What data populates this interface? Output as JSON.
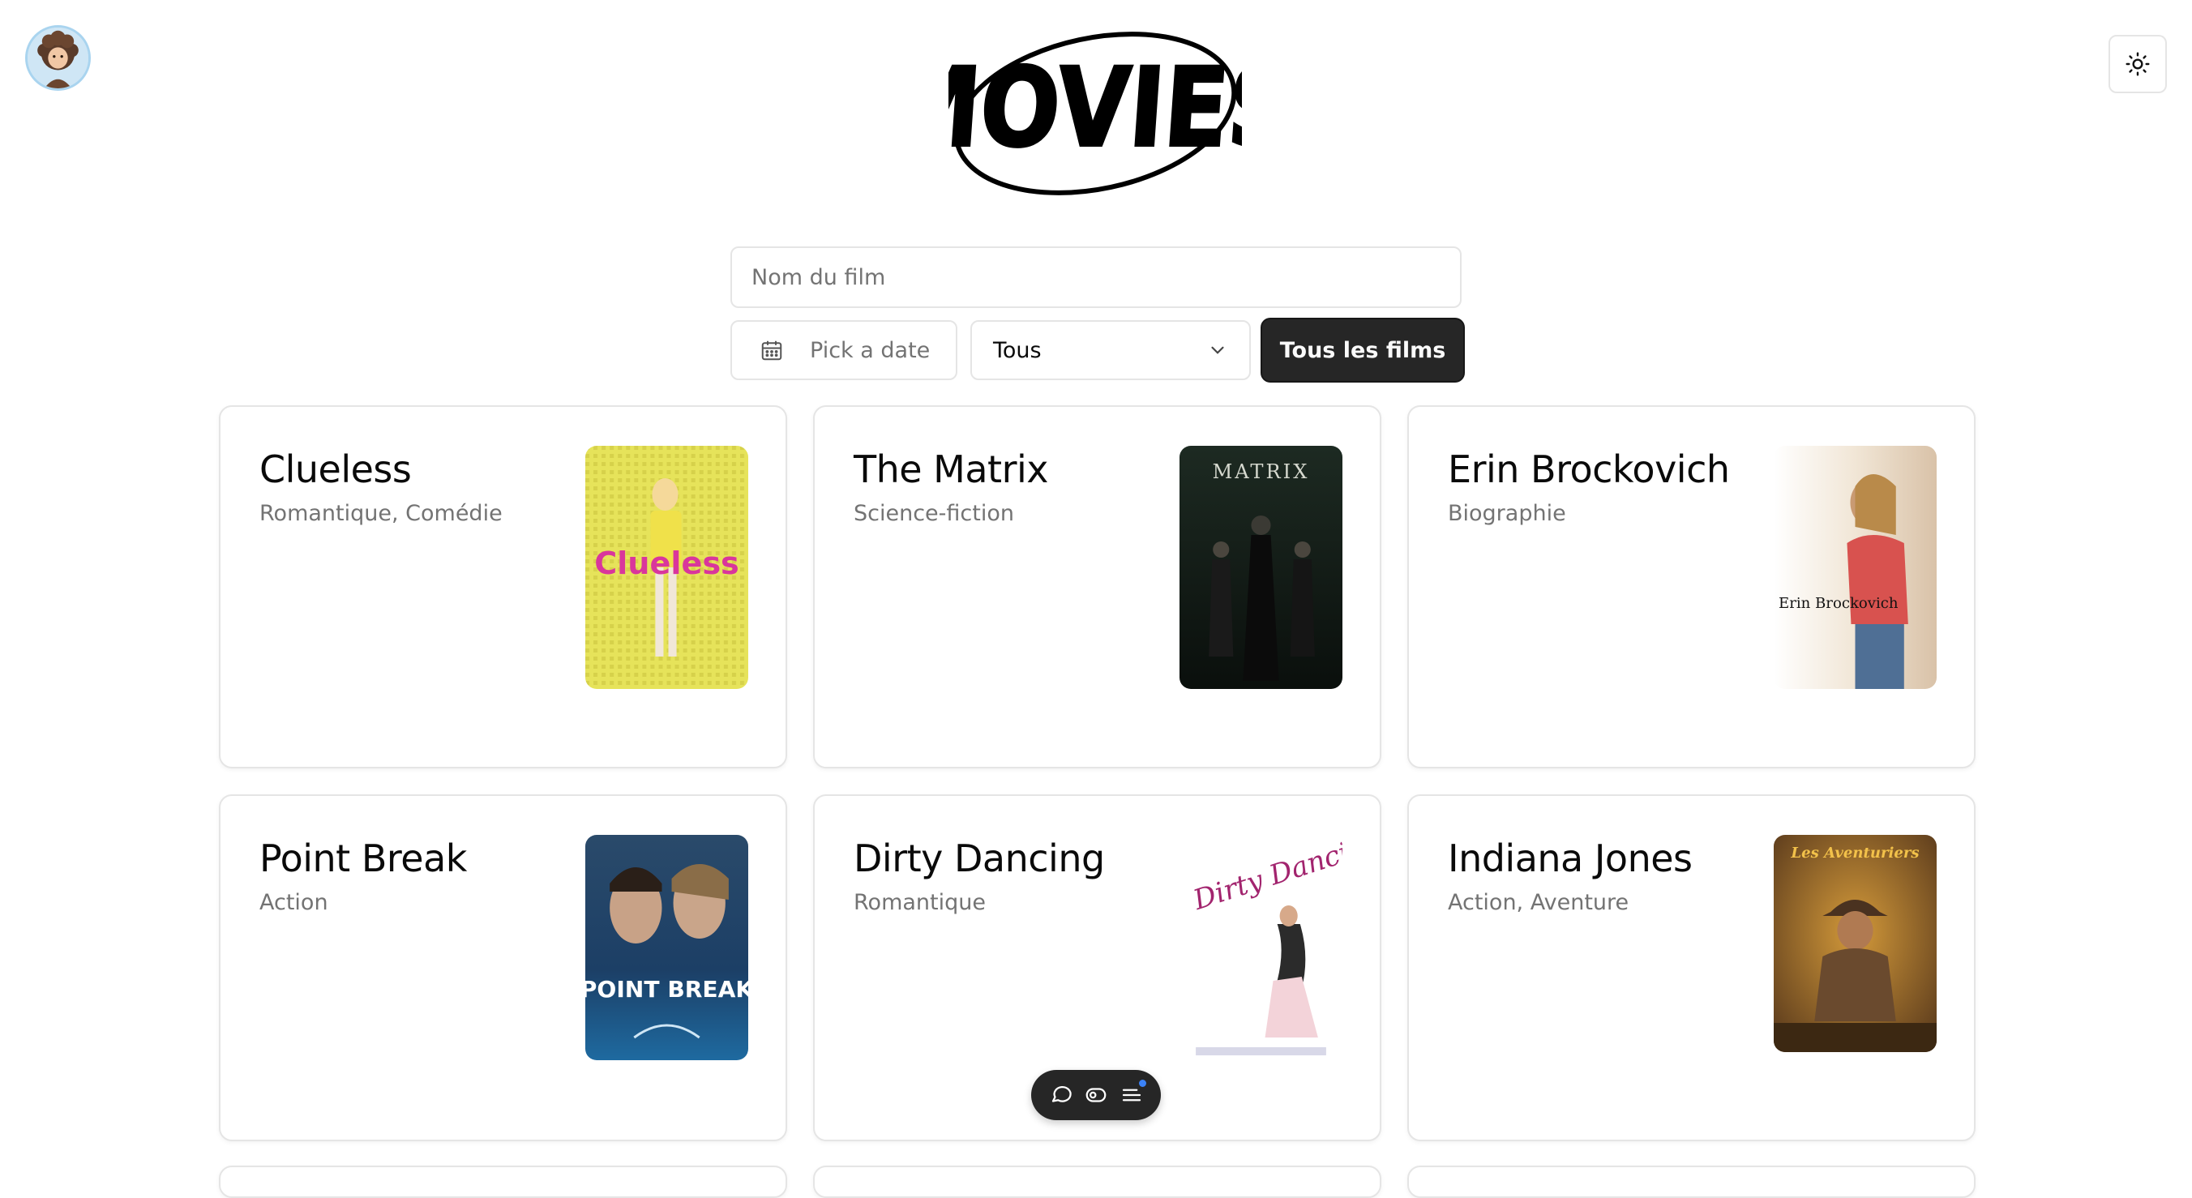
{
  "header": {
    "logo_text": "MOVIES"
  },
  "search": {
    "placeholder": "Nom du film",
    "value": ""
  },
  "filters": {
    "date_placeholder": "Pick a date",
    "genre_selected": "Tous",
    "all_films_label": "Tous les films"
  },
  "movies": [
    {
      "title": "Clueless",
      "genres": "Romantique, Comédie",
      "poster_text": "Clueless"
    },
    {
      "title": "The Matrix",
      "genres": "Science-fiction",
      "poster_text": "MATRIX"
    },
    {
      "title": "Erin Brockovich",
      "genres": "Biographie",
      "poster_text": "Erin Brockovich"
    },
    {
      "title": "Point Break",
      "genres": "Action",
      "poster_text": "POINT BREAK"
    },
    {
      "title": "Dirty Dancing",
      "genres": "Romantique",
      "poster_text": "Dirty Dancing"
    },
    {
      "title": "Indiana Jones",
      "genres": "Action, Aventure",
      "poster_text": "Les Aventuriers"
    }
  ],
  "icons": {
    "avatar": "avatar-image",
    "theme": "sun-icon",
    "date": "calendar-icon",
    "select": "chevron-down-icon",
    "floating": [
      "chat-icon",
      "toggle-icon",
      "menu-icon"
    ]
  },
  "colors": {
    "primary_button": "#262626",
    "border": "#e5e5e5",
    "muted_text": "#737373",
    "notification_dot": "#3b82f6"
  }
}
